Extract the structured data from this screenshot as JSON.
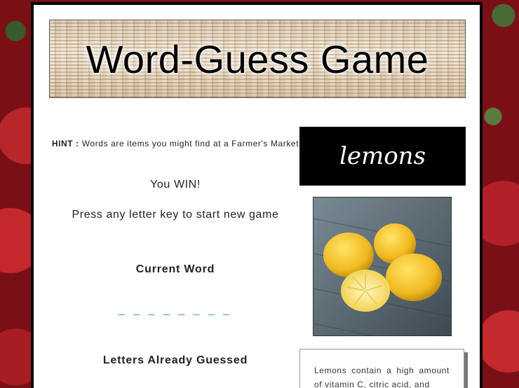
{
  "game": {
    "title": "Word-Guess Game"
  },
  "hint": {
    "label": "HINT :",
    "text": "Words are items you might find at a Farmer's Market"
  },
  "status": {
    "result": "You WIN!",
    "prompt": "Press any letter key to start new game"
  },
  "current_word": {
    "label": "Current Word",
    "value": "_ _ _ _ _ _ _ _"
  },
  "letters_guessed": {
    "label": "Letters Already Guessed"
  },
  "answer": {
    "word": "lemons",
    "image": "lemons-photo"
  },
  "fact": {
    "text": "Lemons contain a high amount of vitamin C, citric acid, and"
  },
  "colors": {
    "answer_bg": "#000000",
    "answer_text": "#ffffff",
    "current_word": "#3cb43c"
  }
}
